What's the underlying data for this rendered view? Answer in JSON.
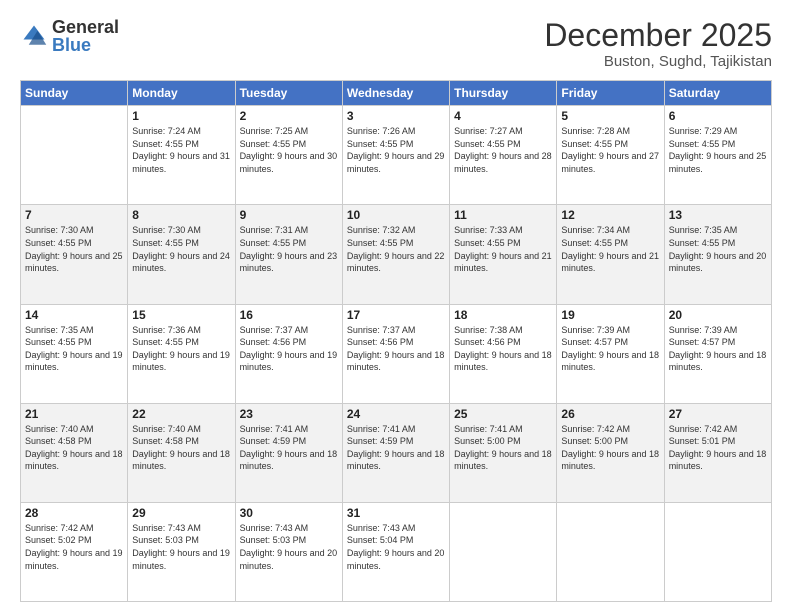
{
  "logo": {
    "general": "General",
    "blue": "Blue"
  },
  "header": {
    "month_title": "December 2025",
    "location": "Buston, Sughd, Tajikistan"
  },
  "days_of_week": [
    "Sunday",
    "Monday",
    "Tuesday",
    "Wednesday",
    "Thursday",
    "Friday",
    "Saturday"
  ],
  "weeks": [
    [
      {
        "day": "",
        "sunrise": "",
        "sunset": "",
        "daylight": ""
      },
      {
        "day": "1",
        "sunrise": "Sunrise: 7:24 AM",
        "sunset": "Sunset: 4:55 PM",
        "daylight": "Daylight: 9 hours and 31 minutes."
      },
      {
        "day": "2",
        "sunrise": "Sunrise: 7:25 AM",
        "sunset": "Sunset: 4:55 PM",
        "daylight": "Daylight: 9 hours and 30 minutes."
      },
      {
        "day": "3",
        "sunrise": "Sunrise: 7:26 AM",
        "sunset": "Sunset: 4:55 PM",
        "daylight": "Daylight: 9 hours and 29 minutes."
      },
      {
        "day": "4",
        "sunrise": "Sunrise: 7:27 AM",
        "sunset": "Sunset: 4:55 PM",
        "daylight": "Daylight: 9 hours and 28 minutes."
      },
      {
        "day": "5",
        "sunrise": "Sunrise: 7:28 AM",
        "sunset": "Sunset: 4:55 PM",
        "daylight": "Daylight: 9 hours and 27 minutes."
      },
      {
        "day": "6",
        "sunrise": "Sunrise: 7:29 AM",
        "sunset": "Sunset: 4:55 PM",
        "daylight": "Daylight: 9 hours and 25 minutes."
      }
    ],
    [
      {
        "day": "7",
        "sunrise": "Sunrise: 7:30 AM",
        "sunset": "Sunset: 4:55 PM",
        "daylight": "Daylight: 9 hours and 25 minutes."
      },
      {
        "day": "8",
        "sunrise": "Sunrise: 7:30 AM",
        "sunset": "Sunset: 4:55 PM",
        "daylight": "Daylight: 9 hours and 24 minutes."
      },
      {
        "day": "9",
        "sunrise": "Sunrise: 7:31 AM",
        "sunset": "Sunset: 4:55 PM",
        "daylight": "Daylight: 9 hours and 23 minutes."
      },
      {
        "day": "10",
        "sunrise": "Sunrise: 7:32 AM",
        "sunset": "Sunset: 4:55 PM",
        "daylight": "Daylight: 9 hours and 22 minutes."
      },
      {
        "day": "11",
        "sunrise": "Sunrise: 7:33 AM",
        "sunset": "Sunset: 4:55 PM",
        "daylight": "Daylight: 9 hours and 21 minutes."
      },
      {
        "day": "12",
        "sunrise": "Sunrise: 7:34 AM",
        "sunset": "Sunset: 4:55 PM",
        "daylight": "Daylight: 9 hours and 21 minutes."
      },
      {
        "day": "13",
        "sunrise": "Sunrise: 7:35 AM",
        "sunset": "Sunset: 4:55 PM",
        "daylight": "Daylight: 9 hours and 20 minutes."
      }
    ],
    [
      {
        "day": "14",
        "sunrise": "Sunrise: 7:35 AM",
        "sunset": "Sunset: 4:55 PM",
        "daylight": "Daylight: 9 hours and 19 minutes."
      },
      {
        "day": "15",
        "sunrise": "Sunrise: 7:36 AM",
        "sunset": "Sunset: 4:55 PM",
        "daylight": "Daylight: 9 hours and 19 minutes."
      },
      {
        "day": "16",
        "sunrise": "Sunrise: 7:37 AM",
        "sunset": "Sunset: 4:56 PM",
        "daylight": "Daylight: 9 hours and 19 minutes."
      },
      {
        "day": "17",
        "sunrise": "Sunrise: 7:37 AM",
        "sunset": "Sunset: 4:56 PM",
        "daylight": "Daylight: 9 hours and 18 minutes."
      },
      {
        "day": "18",
        "sunrise": "Sunrise: 7:38 AM",
        "sunset": "Sunset: 4:56 PM",
        "daylight": "Daylight: 9 hours and 18 minutes."
      },
      {
        "day": "19",
        "sunrise": "Sunrise: 7:39 AM",
        "sunset": "Sunset: 4:57 PM",
        "daylight": "Daylight: 9 hours and 18 minutes."
      },
      {
        "day": "20",
        "sunrise": "Sunrise: 7:39 AM",
        "sunset": "Sunset: 4:57 PM",
        "daylight": "Daylight: 9 hours and 18 minutes."
      }
    ],
    [
      {
        "day": "21",
        "sunrise": "Sunrise: 7:40 AM",
        "sunset": "Sunset: 4:58 PM",
        "daylight": "Daylight: 9 hours and 18 minutes."
      },
      {
        "day": "22",
        "sunrise": "Sunrise: 7:40 AM",
        "sunset": "Sunset: 4:58 PM",
        "daylight": "Daylight: 9 hours and 18 minutes."
      },
      {
        "day": "23",
        "sunrise": "Sunrise: 7:41 AM",
        "sunset": "Sunset: 4:59 PM",
        "daylight": "Daylight: 9 hours and 18 minutes."
      },
      {
        "day": "24",
        "sunrise": "Sunrise: 7:41 AM",
        "sunset": "Sunset: 4:59 PM",
        "daylight": "Daylight: 9 hours and 18 minutes."
      },
      {
        "day": "25",
        "sunrise": "Sunrise: 7:41 AM",
        "sunset": "Sunset: 5:00 PM",
        "daylight": "Daylight: 9 hours and 18 minutes."
      },
      {
        "day": "26",
        "sunrise": "Sunrise: 7:42 AM",
        "sunset": "Sunset: 5:00 PM",
        "daylight": "Daylight: 9 hours and 18 minutes."
      },
      {
        "day": "27",
        "sunrise": "Sunrise: 7:42 AM",
        "sunset": "Sunset: 5:01 PM",
        "daylight": "Daylight: 9 hours and 18 minutes."
      }
    ],
    [
      {
        "day": "28",
        "sunrise": "Sunrise: 7:42 AM",
        "sunset": "Sunset: 5:02 PM",
        "daylight": "Daylight: 9 hours and 19 minutes."
      },
      {
        "day": "29",
        "sunrise": "Sunrise: 7:43 AM",
        "sunset": "Sunset: 5:03 PM",
        "daylight": "Daylight: 9 hours and 19 minutes."
      },
      {
        "day": "30",
        "sunrise": "Sunrise: 7:43 AM",
        "sunset": "Sunset: 5:03 PM",
        "daylight": "Daylight: 9 hours and 20 minutes."
      },
      {
        "day": "31",
        "sunrise": "Sunrise: 7:43 AM",
        "sunset": "Sunset: 5:04 PM",
        "daylight": "Daylight: 9 hours and 20 minutes."
      },
      {
        "day": "",
        "sunrise": "",
        "sunset": "",
        "daylight": ""
      },
      {
        "day": "",
        "sunrise": "",
        "sunset": "",
        "daylight": ""
      },
      {
        "day": "",
        "sunrise": "",
        "sunset": "",
        "daylight": ""
      }
    ]
  ]
}
